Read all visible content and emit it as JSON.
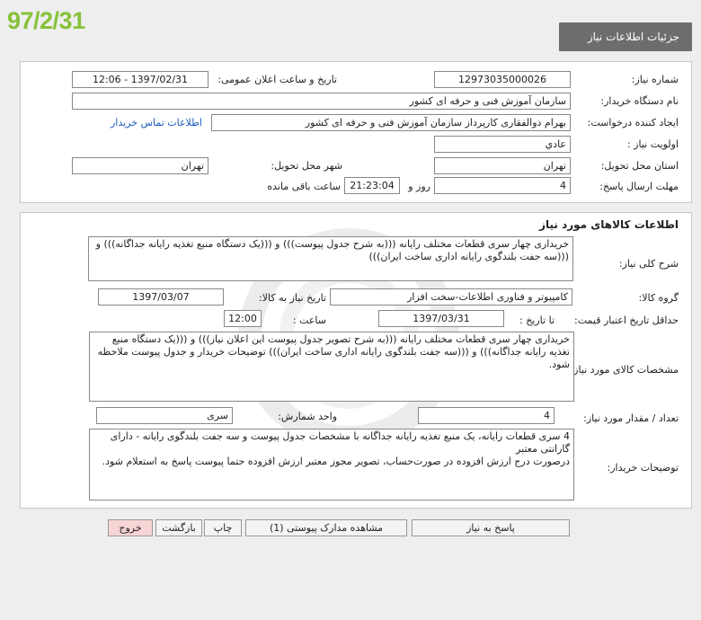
{
  "stamp_date": "97/2/31",
  "header": {
    "title": "جزئیات اطلاعات نیاز"
  },
  "info": {
    "need_number_label": "شماره نیاز:",
    "need_number": "12973035000026",
    "announce_label": "تاریخ و ساعت اعلان عمومی:",
    "announce_value": "1397/02/31 - 12:06",
    "buyer_org_label": "نام دستگاه خریدار:",
    "buyer_org": "سازمان آموزش فنی و حرفه ای کشور",
    "requester_label": "ایجاد کننده درخواست:",
    "requester": "بهرام ذوالفقاری کارپرداز سازمان آموزش فنی و حرفه ای کشور",
    "contact_link": "اطلاعات تماس خریدار",
    "priority_label": "اولویت نیاز :",
    "priority": "عادي",
    "province_label": "استان محل تحویل:",
    "province": "تهران",
    "city_label": "شهر محل تحویل:",
    "city": "تهران",
    "deadline_label": "مهلت ارسال پاسخ:",
    "deadline_days": "4",
    "days_label": "روز و",
    "deadline_time": "21:23:04",
    "remaining_label": "ساعت باقی مانده"
  },
  "goods": {
    "section_title": "اطلاعات کالاهای مورد نیاز",
    "general_desc_label": "شرح کلی نیاز:",
    "general_desc": "خریداری چهار سری قطعات مختلف رایانه (((به شرح جدول پیوست))) و (((یک دستگاه منبع تغذیه رایانه جداگانه))) و (((سه جفت بلندگوی رایانه اداری ساخت ایران)))",
    "group_label": "گروه کالا:",
    "group": "کامپیوتر و فناوری اطلاعات-سخت افزار",
    "need_date_label": "تاریخ نیاز به کالا:",
    "need_date": "1397/03/07",
    "min_validity_label": "حداقل تاریخ اعتبار قیمت:",
    "to_date_label": "تا تاریخ :",
    "to_date": "1397/03/31",
    "time_label": "ساعت :",
    "time": "12:00",
    "specs_label": "مشخصات کالای مورد نیاز:",
    "specs": "خریداری چهار سری قطعات مختلف رایانه (((به شرح تصویر جدول پیوست این اعلان نیاز))) و (((یک دستگاه منبع تغذیه رایانه جداگانه))) و (((سه جفت بلندگوی رایانه اداری ساخت ایران))) توضیحات خریدار و جدول پیوست ملاحظه شود.",
    "qty_label": "تعداد / مقدار مورد نیاز:",
    "qty": "4",
    "unit_label": "واحد شمارش:",
    "unit": "سری",
    "buyer_notes_label": "توضیحات خریدار:",
    "buyer_notes_1": "4 سری قطعات رایانه، یک منبع تغذیه رایانه جداگانه با مشخصات جدول پیوست و سه جفت بلندگوی رایانه - دارای گارانتی معتبر",
    "buyer_notes_2": "درصورت درج ارزش افزوده در صورت‌حساب، تصویر مجوز معتبر ارزش افزوده حتما پیوست پاسخ به استعلام شود."
  },
  "buttons": {
    "reply": "پاسخ به نیاز",
    "attachments": "مشاهده مدارک پیوستی (1)",
    "print": "چاپ",
    "back": "بازگشت",
    "exit": "خروج"
  }
}
